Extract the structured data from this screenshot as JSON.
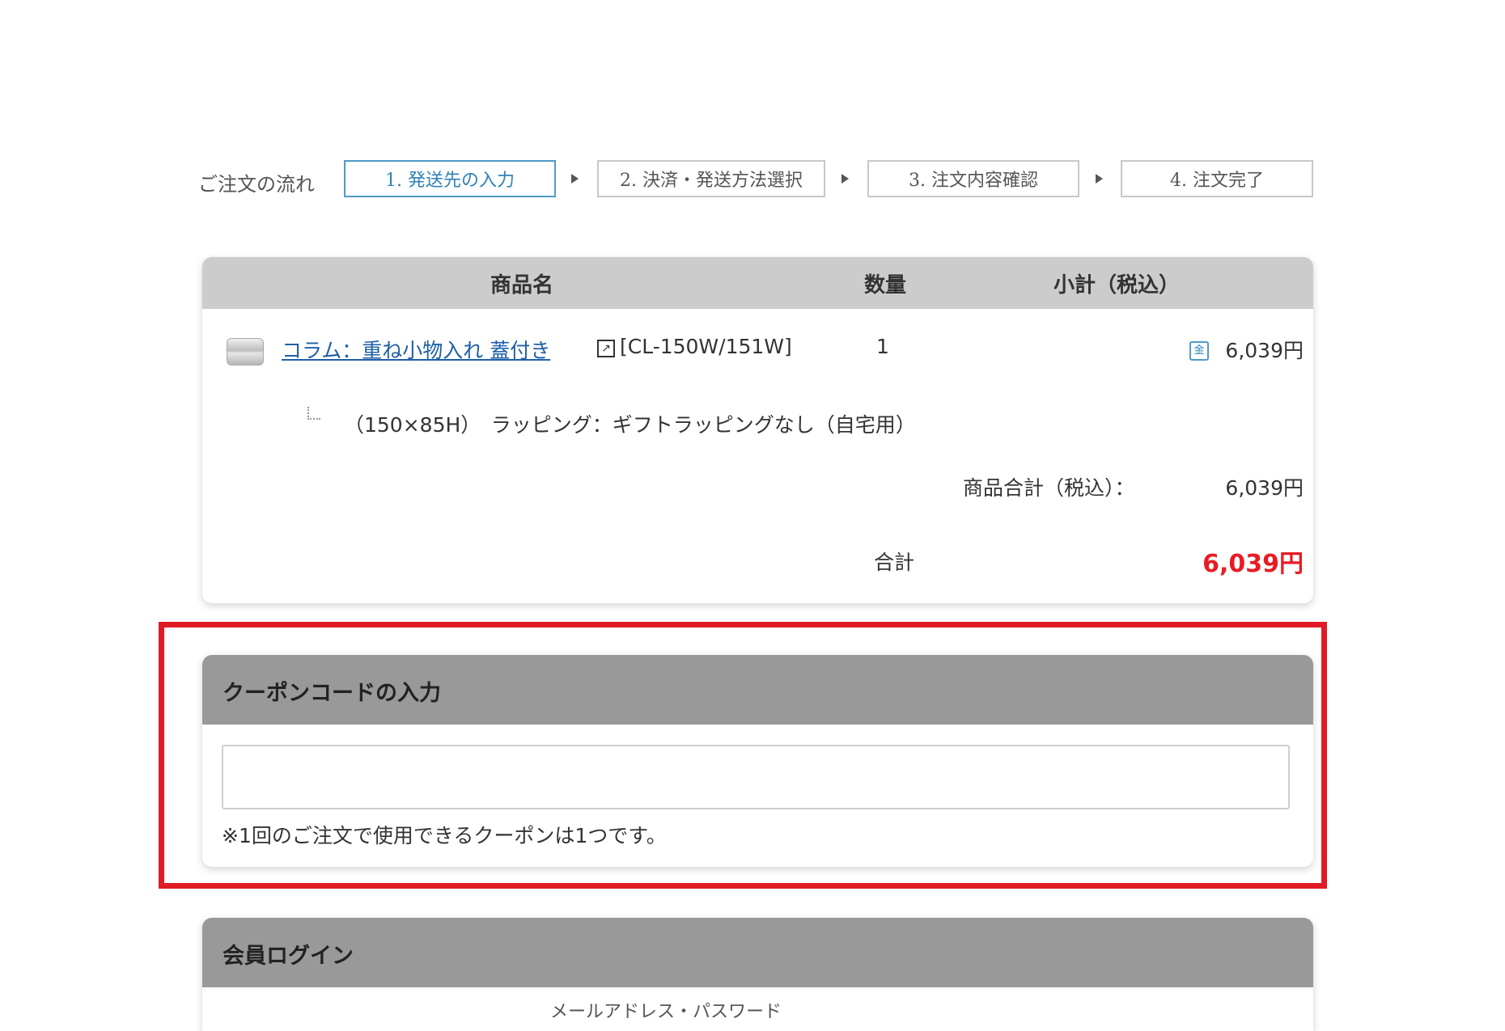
{
  "flow": {
    "label": "ご注文の流れ",
    "steps": [
      {
        "label": "1. 発送先の入力",
        "active": true
      },
      {
        "label": "2. 決済・発送方法選択",
        "active": false
      },
      {
        "label": "3. 注文内容確認",
        "active": false
      },
      {
        "label": "4. 注文完了",
        "active": false
      }
    ]
  },
  "cart": {
    "headers": {
      "name": "商品名",
      "qty": "数量",
      "subtotal": "小計（税込）"
    },
    "item": {
      "name": "コラム：重ね小物入れ 蓋付き",
      "sku": "[CL-150W/151W]",
      "quantity": "1",
      "price": "6,039円",
      "option": "（150×85H）　ラッピング：ギフトラッピングなし（自宅用）",
      "coin_icon_glyph": "金"
    },
    "subtotal_label": "商品合計（税込）：",
    "subtotal_value": "6,039円",
    "total_label": "合計",
    "total_value": "6,039円",
    "total_color": "#e81c24"
  },
  "coupon": {
    "title": "クーポンコードの入力",
    "input_value": "",
    "input_placeholder": "",
    "note": "※1回のご注文で使用できるクーポンは1つです。",
    "highlight_color": "#e01b24"
  },
  "login": {
    "title": "会員ログイン",
    "partial_text": "メールアドレス・パスワード"
  }
}
